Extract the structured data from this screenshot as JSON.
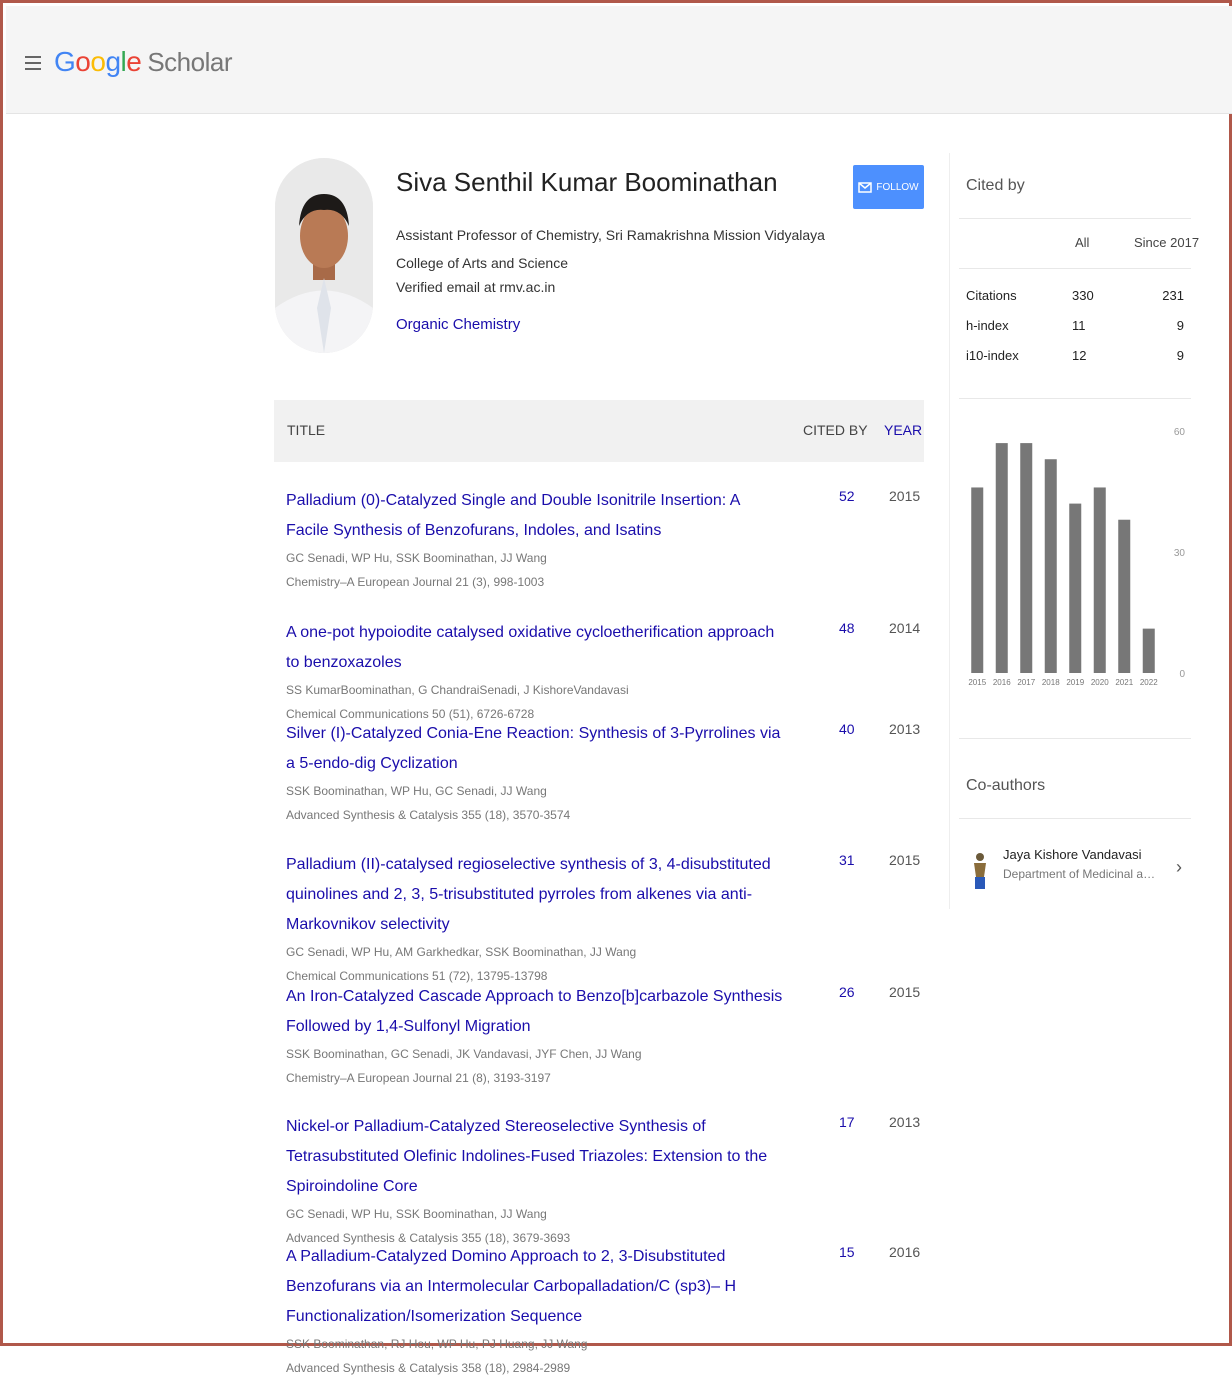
{
  "header": {
    "logo": {
      "g1": "G",
      "o1": "o",
      "o2": "o",
      "g2": "g",
      "l": "l",
      "e": "e",
      "scholar": "Scholar"
    }
  },
  "profile": {
    "name": "Siva Senthil Kumar Boominathan",
    "affiliation": "Assistant Professor of Chemistry, Sri Ramakrishna Mission Vidyalaya College of Arts and Science",
    "email": "Verified email at rmv.ac.in",
    "interest": "Organic Chemistry",
    "follow_label": "FOLLOW"
  },
  "table": {
    "col_title": "TITLE",
    "col_cited": "CITED BY",
    "col_year": "YEAR"
  },
  "articles": [
    {
      "title": "Palladium (0)-Catalyzed Single and Double Isonitrile Insertion: A Facile Synthesis of Benzofurans, Indoles, and Isatins",
      "authors": "GC Senadi, WP Hu, SSK Boominathan, JJ Wang",
      "venue": "Chemistry–A European Journal 21 (3), 998-1003",
      "cited": "52",
      "year": "2015"
    },
    {
      "title": "A one-pot hypoiodite catalysed oxidative cycloetherification approach to benzoxazoles",
      "authors": "SS KumarBoominathan, G ChandraiSenadi, J KishoreVandavasi",
      "venue": "Chemical Communications 50 (51), 6726-6728",
      "cited": "48",
      "year": "2014"
    },
    {
      "title": "Silver (I)-Catalyzed Conia-Ene Reaction: Synthesis of 3-Pyrrolines via a 5-endo-dig Cyclization",
      "authors": "SSK Boominathan, WP Hu, GC Senadi, JJ Wang",
      "venue": "Advanced Synthesis & Catalysis 355 (18), 3570-3574",
      "cited": "40",
      "year": "2013"
    },
    {
      "title": "Palladium (II)-catalysed regioselective synthesis of 3, 4-disubstituted quinolines and 2, 3, 5-trisubstituted pyrroles from alkenes via anti-Markovnikov selectivity",
      "authors": "GC Senadi, WP Hu, AM Garkhedkar, SSK Boominathan, JJ Wang",
      "venue": "Chemical Communications 51 (72), 13795-13798",
      "cited": "31",
      "year": "2015"
    },
    {
      "title": "An Iron-Catalyzed Cascade Approach to Benzo[b]carbazole Synthesis Followed by 1,4-Sulfonyl Migration",
      "authors": "SSK Boominathan, GC Senadi, JK Vandavasi, JYF Chen, JJ Wang",
      "venue": "Chemistry–A European Journal 21 (8), 3193-3197",
      "cited": "26",
      "year": "2015"
    },
    {
      "title": "Nickel-or Palladium-Catalyzed Stereoselective Synthesis of Tetrasubstituted Olefinic Indolines-Fused Triazoles: Extension to the Spiroindoline Core",
      "authors": "GC Senadi, WP Hu, SSK Boominathan, JJ Wang",
      "venue": "Advanced Synthesis & Catalysis 355 (18), 3679-3693",
      "cited": "17",
      "year": "2013"
    },
    {
      "title": "A Palladium-Catalyzed Domino Approach to 2, 3-Disubstituted Benzofurans via an Intermolecular Carbopalladation/C (sp3)– H Functionalization/Isomerization Sequence",
      "authors": "SSK Boominathan, RJ Hou, WP Hu, PJ Huang, JJ Wang",
      "venue": "Advanced Synthesis & Catalysis 358 (18), 2984-2989",
      "cited": "15",
      "year": "2016"
    }
  ],
  "cited_by": {
    "title": "Cited by",
    "col_all": "All",
    "col_since": "Since 2017",
    "rows": [
      {
        "label": "Citations",
        "all": "330",
        "since": "231"
      },
      {
        "label": "h-index",
        "all": "11",
        "since": "9"
      },
      {
        "label": "i10-index",
        "all": "12",
        "since": "9"
      }
    ]
  },
  "chart_data": {
    "type": "bar",
    "categories": [
      "2015",
      "2016",
      "2017",
      "2018",
      "2019",
      "2020",
      "2021",
      "2022"
    ],
    "values": [
      46,
      57,
      57,
      53,
      42,
      46,
      38,
      11
    ],
    "yticks": [
      "60",
      "30",
      "0"
    ],
    "ylim": [
      0,
      60
    ],
    "bar_color": "#777777"
  },
  "coauthors": {
    "title": "Co-authors",
    "items": [
      {
        "name": "Jaya Kishore Vandavasi",
        "affiliation": "Department of Medicinal and Ap..."
      }
    ]
  }
}
